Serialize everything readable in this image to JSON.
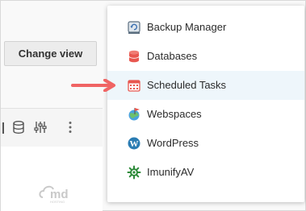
{
  "toolbar": {
    "change_view_label": "Change view"
  },
  "menu": {
    "items": [
      {
        "label": "Backup Manager",
        "icon": "backup-manager-icon"
      },
      {
        "label": "Databases",
        "icon": "database-icon"
      },
      {
        "label": "Scheduled Tasks",
        "icon": "calendar-icon",
        "highlighted": true
      },
      {
        "label": "Webspaces",
        "icon": "webspaces-icon"
      },
      {
        "label": "WordPress",
        "icon": "wordpress-icon"
      },
      {
        "label": "ImunifyAV",
        "icon": "imunify-icon"
      }
    ]
  },
  "colors": {
    "arrow": "#f06464",
    "highlight_bg": "#eef6fb",
    "database_red": "#e8574f",
    "wordpress_blue": "#2a7cb3",
    "imunify_green": "#2e8b3a"
  }
}
